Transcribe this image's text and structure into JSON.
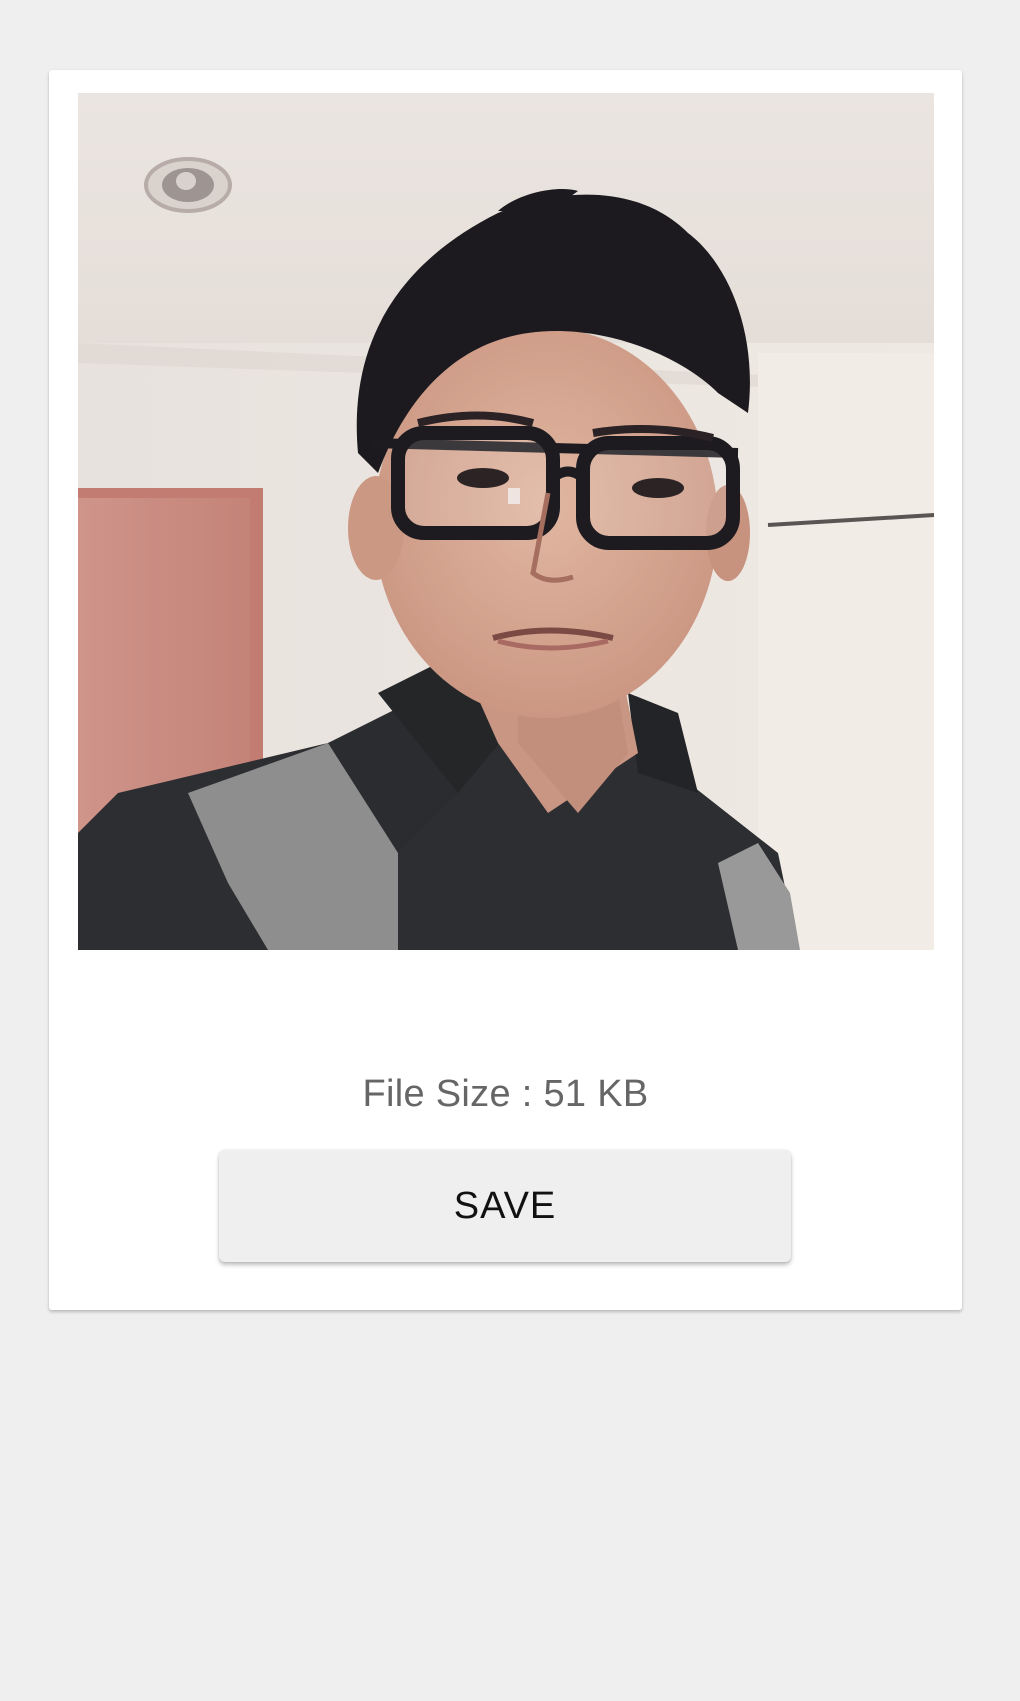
{
  "image_preview": {
    "description_icon": "profile-photo"
  },
  "file_size_text": "File Size : 51 KB",
  "save_button_label": "SAVE",
  "colors": {
    "background": "#efefef",
    "card": "#ffffff",
    "button": "#efefef",
    "file_size_text": "#666666"
  }
}
